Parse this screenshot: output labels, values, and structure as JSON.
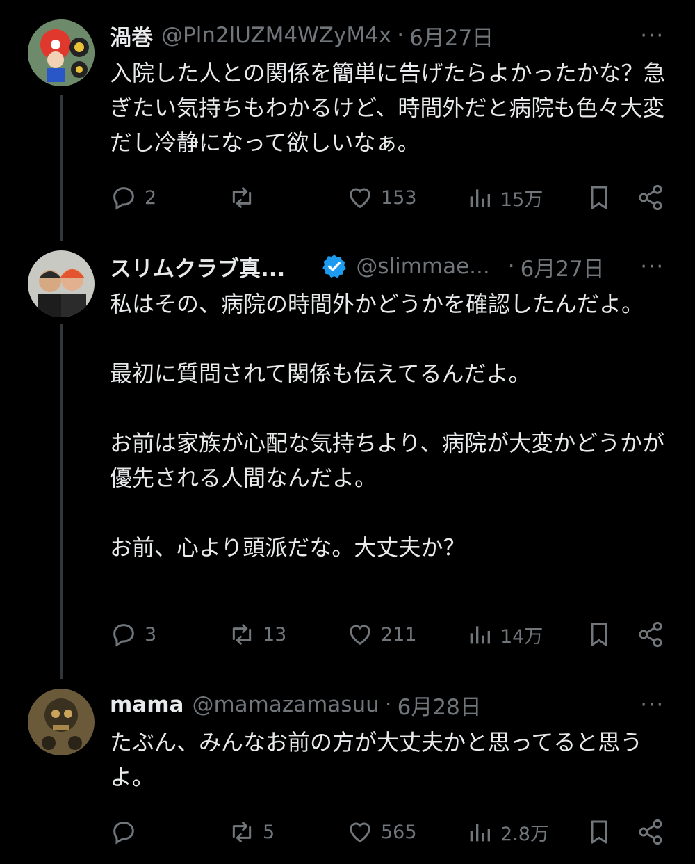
{
  "tweets": [
    {
      "name": "渦巻",
      "handle": "@Pln2lUZM4WZyM4x",
      "date": "6月27日",
      "text": "入院した人との関係を簡単に告げたらよかったかな？急ぎたい気持ちもわかるけど、時間外だと病院も色々大変だし冷静になって欲しいなぁ。",
      "replies": "2",
      "retweets": "",
      "likes": "153",
      "views": "15万"
    },
    {
      "name": "スリムクラブ真...",
      "verified": true,
      "handle": "@slimmae...",
      "date": "6月27日",
      "text": "私はその、病院の時間外かどうかを確認したんだよ。\n\n最初に質問されて関係も伝えてるんだよ。\n\nお前は家族が心配な気持ちより、病院が大変かどうかが優先される人間なんだよ。\n\nお前、心より頭派だな。大丈夫か？",
      "replies": "3",
      "retweets": "13",
      "likes": "211",
      "views": "14万"
    },
    {
      "name": "mama",
      "handle": "@mamazamasuu",
      "date": "6月28日",
      "text": "たぶん、みんなお前の方が大丈夫かと思ってると思うよ。",
      "replies": "",
      "retweets": "5",
      "likes": "565",
      "views": "2.8万"
    }
  ],
  "more_label": "···",
  "dot_separator": "·",
  "icons": [
    "reply-icon",
    "retweet-icon",
    "like-icon",
    "views-icon",
    "bookmark-icon",
    "share-icon",
    "verified-badge-icon",
    "more-icon"
  ],
  "colors": {
    "background": "#000000",
    "text": "#e7e9ea",
    "muted": "#71767b",
    "verified": "#1d9bf0",
    "thread_line": "#333639"
  }
}
